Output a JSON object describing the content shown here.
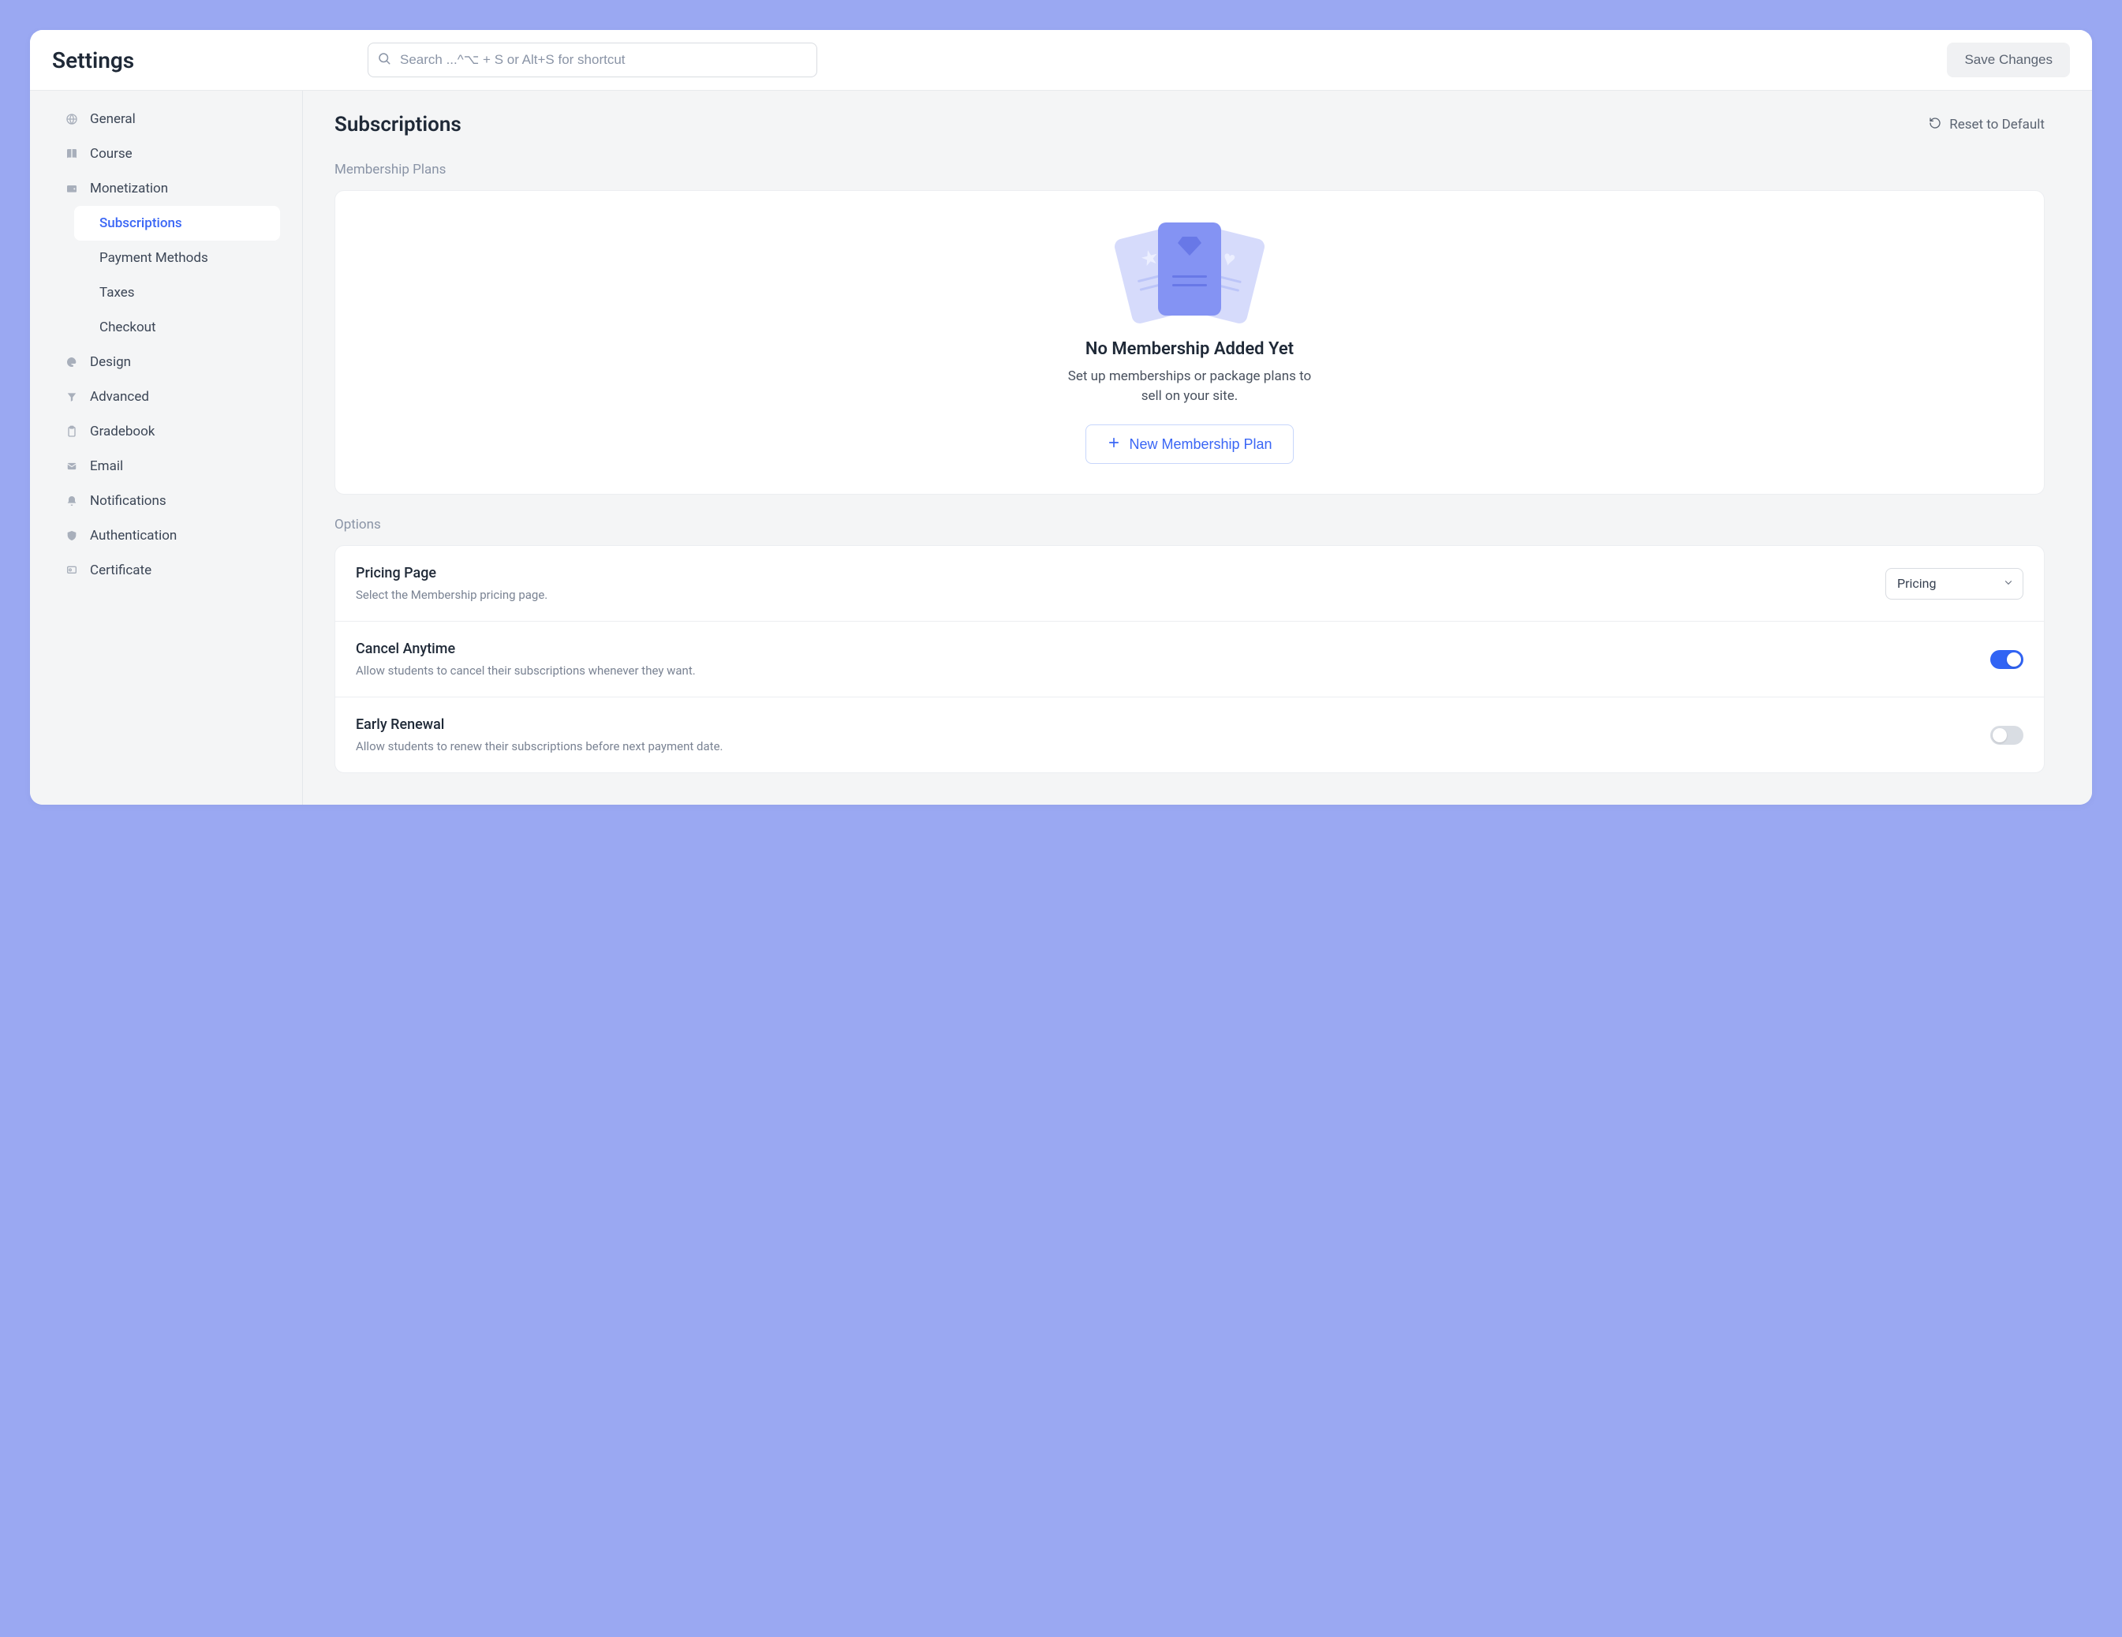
{
  "topbar": {
    "title": "Settings",
    "search_placeholder": "Search ...^⌥ + S or Alt+S for shortcut",
    "save_label": "Save Changes"
  },
  "sidebar": {
    "items": [
      {
        "key": "general",
        "label": "General",
        "icon": "globe"
      },
      {
        "key": "course",
        "label": "Course",
        "icon": "book"
      },
      {
        "key": "monetization",
        "label": "Monetization",
        "icon": "wallet",
        "children": [
          {
            "key": "subscriptions",
            "label": "Subscriptions",
            "active": true
          },
          {
            "key": "payment-methods",
            "label": "Payment Methods",
            "active": false
          },
          {
            "key": "taxes",
            "label": "Taxes",
            "active": false
          },
          {
            "key": "checkout",
            "label": "Checkout",
            "active": false
          }
        ]
      },
      {
        "key": "design",
        "label": "Design",
        "icon": "palette"
      },
      {
        "key": "advanced",
        "label": "Advanced",
        "icon": "filter"
      },
      {
        "key": "gradebook",
        "label": "Gradebook",
        "icon": "clipboard"
      },
      {
        "key": "email",
        "label": "Email",
        "icon": "mail"
      },
      {
        "key": "notifications",
        "label": "Notifications",
        "icon": "bell"
      },
      {
        "key": "authentication",
        "label": "Authentication",
        "icon": "shield"
      },
      {
        "key": "certificate",
        "label": "Certificate",
        "icon": "badge"
      }
    ]
  },
  "main": {
    "title": "Subscriptions",
    "reset_label": "Reset to Default",
    "membership": {
      "section_label": "Membership Plans",
      "empty_title": "No Membership Added Yet",
      "empty_desc": "Set up memberships or package plans to sell on your site.",
      "new_btn": "New Membership Plan"
    },
    "options": {
      "section_label": "Options",
      "rows": [
        {
          "title": "Pricing Page",
          "desc": "Select the Membership pricing page.",
          "control": "select",
          "value": "Pricing"
        },
        {
          "title": "Cancel Anytime",
          "desc": "Allow students to cancel their subscriptions whenever they want.",
          "control": "toggle",
          "value": true
        },
        {
          "title": "Early Renewal",
          "desc": "Allow students to renew their subscriptions before next payment date.",
          "control": "toggle",
          "value": false
        }
      ]
    }
  },
  "colors": {
    "accent": "#3a66f5",
    "page_bg": "#9aa8f2"
  }
}
